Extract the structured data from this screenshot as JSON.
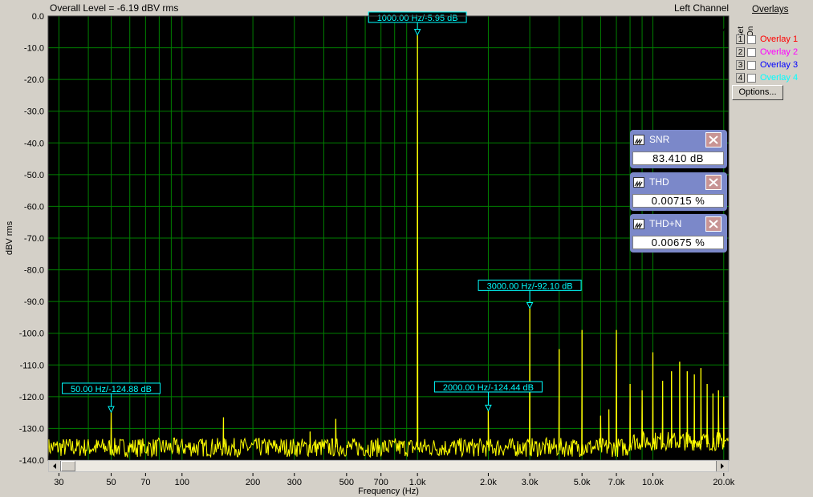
{
  "header": {
    "overall_level": "Overall Level = -6.19 dBV rms",
    "channel": "Left Channel"
  },
  "overlays": {
    "title": "Overlays",
    "set_label": "Set",
    "on_label": "On",
    "items": [
      {
        "num": "1",
        "label": "Overlay 1",
        "color": "#ff0000"
      },
      {
        "num": "2",
        "label": "Overlay 2",
        "color": "#ff00ff"
      },
      {
        "num": "3",
        "label": "Overlay 3",
        "color": "#0000ff"
      },
      {
        "num": "4",
        "label": "Overlay 4",
        "color": "#00ffff"
      }
    ],
    "options_label": "Options..."
  },
  "meters": [
    {
      "name": "SNR",
      "value": "83.410 dB"
    },
    {
      "name": "THD",
      "value": "0.00715 %"
    },
    {
      "name": "THD+N",
      "value": "0.00675 %"
    }
  ],
  "icons": {
    "meter": "waveform-icon",
    "close": "close-icon",
    "plot_type": "filter-response-icon",
    "scroll_left": "arrow-left-icon",
    "scroll_right": "arrow-right-icon"
  },
  "colors": {
    "plot_bg": "#000000",
    "grid": "#008000",
    "trace": "#ffff00",
    "marker": "#00ffff"
  },
  "chart_data": {
    "type": "line",
    "title": "",
    "xlabel": "Frequency (Hz)",
    "ylabel": "dBV rms",
    "x_scale": "log",
    "xlim": [
      27,
      21000
    ],
    "ylim": [
      -140,
      0
    ],
    "grid": true,
    "y_ticks": [
      "0.0",
      "-10.0",
      "-20.0",
      "-30.0",
      "-40.0",
      "-50.0",
      "-60.0",
      "-70.0",
      "-80.0",
      "-90.0",
      "-100.0",
      "-110.0",
      "-120.0",
      "-130.0",
      "-140.0"
    ],
    "x_tick_labels": [
      {
        "f": 30,
        "label": "30"
      },
      {
        "f": 50,
        "label": "50"
      },
      {
        "f": 70,
        "label": "70"
      },
      {
        "f": 100,
        "label": "100"
      },
      {
        "f": 200,
        "label": "200"
      },
      {
        "f": 300,
        "label": "300"
      },
      {
        "f": 500,
        "label": "500"
      },
      {
        "f": 700,
        "label": "700"
      },
      {
        "f": 1000,
        "label": "1.0k"
      },
      {
        "f": 2000,
        "label": "2.0k"
      },
      {
        "f": 3000,
        "label": "3.0k"
      },
      {
        "f": 5000,
        "label": "5.0k"
      },
      {
        "f": 7000,
        "label": "7.0k"
      },
      {
        "f": 10000,
        "label": "10.0k"
      },
      {
        "f": 20000,
        "label": "20.0k"
      }
    ],
    "noise_floor_db": -136,
    "peaks": [
      {
        "f": 50,
        "db": -124.88
      },
      {
        "f": 150,
        "db": -126.5
      },
      {
        "f": 350,
        "db": -131
      },
      {
        "f": 450,
        "db": -127
      },
      {
        "f": 1000,
        "db": -6.0
      },
      {
        "f": 2000,
        "db": -124.44
      },
      {
        "f": 3000,
        "db": -92.1
      },
      {
        "f": 4000,
        "db": -105
      },
      {
        "f": 5000,
        "db": -99
      },
      {
        "f": 6000,
        "db": -126
      },
      {
        "f": 6500,
        "db": -124
      },
      {
        "f": 7000,
        "db": -99
      },
      {
        "f": 8000,
        "db": -116
      },
      {
        "f": 9000,
        "db": -118
      },
      {
        "f": 10000,
        "db": -106
      },
      {
        "f": 11000,
        "db": -115
      },
      {
        "f": 12000,
        "db": -112
      },
      {
        "f": 13000,
        "db": -109
      },
      {
        "f": 14000,
        "db": -112
      },
      {
        "f": 15000,
        "db": -113
      },
      {
        "f": 16000,
        "db": -111
      },
      {
        "f": 17000,
        "db": -116
      },
      {
        "f": 18000,
        "db": -119
      },
      {
        "f": 19000,
        "db": -118
      },
      {
        "f": 20000,
        "db": -120
      }
    ],
    "annotations": [
      {
        "label": "1000.00 Hz/-5.95 dB",
        "f": 1000,
        "db": -5.95,
        "label_db": -0.5
      },
      {
        "label": "3000.00 Hz/-92.10 dB",
        "f": 3000,
        "db": -92.1,
        "label_db": -85.0
      },
      {
        "label": "2000.00 Hz/-124.44 dB",
        "f": 2000,
        "db": -124.44,
        "label_db": -117.0
      },
      {
        "label": "50.00 Hz/-124.88 dB",
        "f": 50,
        "db": -124.88,
        "label_db": -117.5
      }
    ]
  }
}
